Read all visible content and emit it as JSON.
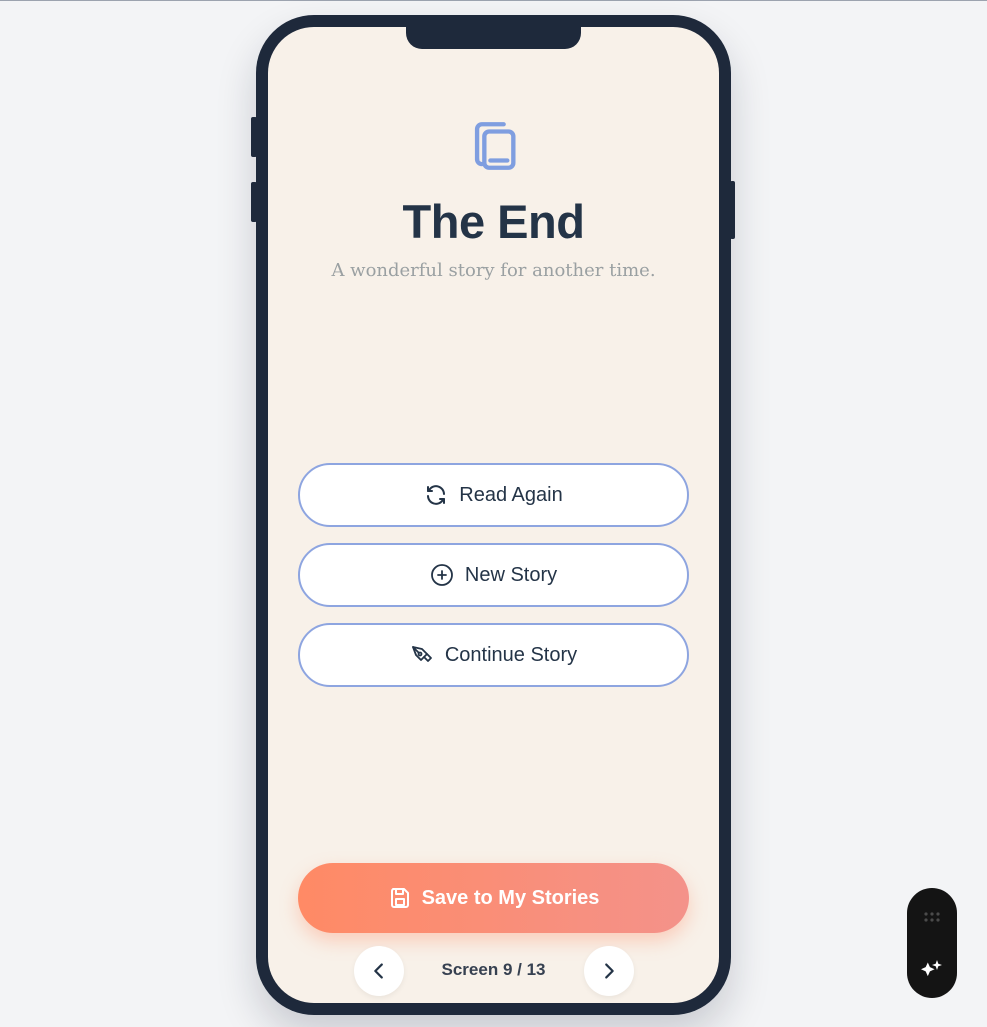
{
  "end_screen": {
    "title": "The End",
    "subtitle": "A wonderful story for another time."
  },
  "actions": {
    "read_again": {
      "label": "Read Again",
      "icon": "refresh-icon"
    },
    "new_story": {
      "label": "New Story",
      "icon": "plus-circle-icon"
    },
    "continue_story": {
      "label": "Continue Story",
      "icon": "pen-tool-icon"
    }
  },
  "save": {
    "label": "Save to My Stories",
    "icon": "save-icon"
  },
  "navigation": {
    "counter": "Screen 9 / 13",
    "prev_icon": "chevron-left-icon",
    "next_icon": "chevron-right-icon"
  },
  "toolbar": {
    "icons": [
      "grip-icon",
      "sparkle-icon"
    ]
  },
  "colors": {
    "accent": "#8ea5e0",
    "primary_text": "#243447",
    "screen_bg": "#f8f1e9",
    "save_gradient_start": "#ff8a65",
    "save_gradient_end": "#f4928a"
  }
}
